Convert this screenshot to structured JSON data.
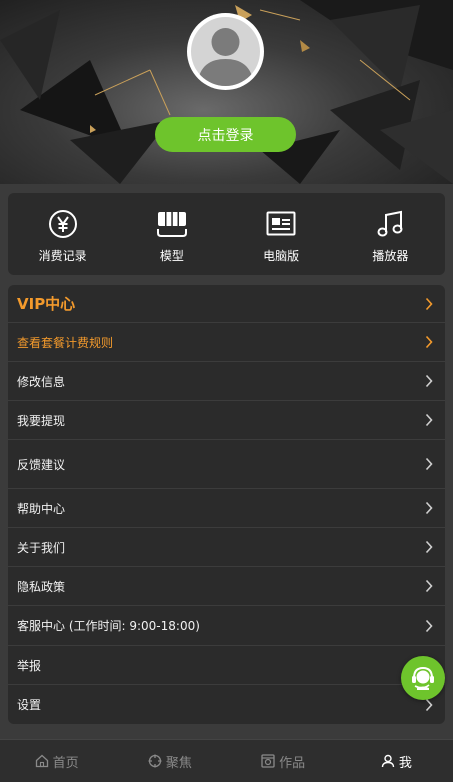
{
  "header": {
    "login_label": "点击登录"
  },
  "quick_actions": [
    {
      "label": "消费记录",
      "icon": "yen-icon"
    },
    {
      "label": "模型",
      "icon": "model-icon"
    },
    {
      "label": "电脑版",
      "icon": "desktop-icon"
    },
    {
      "label": "播放器",
      "icon": "music-icon"
    }
  ],
  "menu": {
    "items": [
      {
        "label": "VIP中心"
      },
      {
        "label": "查看套餐计费规则"
      },
      {
        "label": "修改信息"
      },
      {
        "label": "我要提现"
      },
      {
        "label": "反馈建议"
      },
      {
        "label": "帮助中心"
      },
      {
        "label": "关于我们"
      },
      {
        "label": "隐私政策"
      },
      {
        "label": "客服中心 (工作时间: 9:00-18:00)"
      },
      {
        "label": "举报"
      },
      {
        "label": "设置"
      }
    ]
  },
  "tabbar": {
    "tabs": [
      {
        "label": "首页",
        "icon": "home-icon"
      },
      {
        "label": "聚焦",
        "icon": "focus-icon"
      },
      {
        "label": "作品",
        "icon": "works-icon"
      },
      {
        "label": "我",
        "icon": "user-icon",
        "active": true
      }
    ]
  },
  "colors": {
    "accent_green": "#6ec42c",
    "vip_orange": "#f39a2c",
    "panel": "#2b2b2b",
    "background": "#3b3b3b"
  }
}
